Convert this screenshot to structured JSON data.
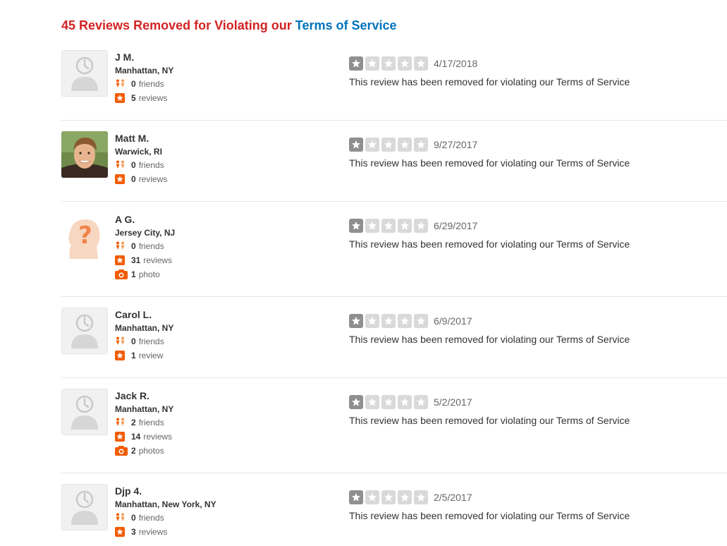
{
  "header": {
    "count_text": "45 Reviews Removed for Violating our",
    "tos_link": "Terms of Service"
  },
  "colors": {
    "header_red": "#d32323",
    "link_blue": "#0073bb",
    "stat_orange": "#f15c00",
    "star_filled": "#8f8f8f",
    "star_empty": "#d9d9d9"
  },
  "reviews": [
    {
      "name": "J M.",
      "location": "Manhattan, NY",
      "avatar": "default-avatar-icon",
      "friends_count": "0",
      "friends_label": "friends",
      "reviews_count": "5",
      "reviews_label": "reviews",
      "rating": 1,
      "date": "4/17/2018",
      "text": "This review has been removed for violating our Terms of Service"
    },
    {
      "name": "Matt M.",
      "location": "Warwick, RI",
      "avatar": "user-photo",
      "friends_count": "0",
      "friends_label": "friends",
      "reviews_count": "0",
      "reviews_label": "reviews",
      "rating": 1,
      "date": "9/27/2017",
      "text": "This review has been removed for violating our Terms of Service"
    },
    {
      "name": "A G.",
      "location": "Jersey City, NJ",
      "avatar": "question-head-icon",
      "friends_count": "0",
      "friends_label": "friends",
      "reviews_count": "31",
      "reviews_label": "reviews",
      "photos_count": "1",
      "photos_label": "photo",
      "rating": 1,
      "date": "6/29/2017",
      "text": "This review has been removed for violating our Terms of Service"
    },
    {
      "name": "Carol L.",
      "location": "Manhattan, NY",
      "avatar": "default-avatar-icon",
      "friends_count": "0",
      "friends_label": "friends",
      "reviews_count": "1",
      "reviews_label": "review",
      "rating": 1,
      "date": "6/9/2017",
      "text": "This review has been removed for violating our Terms of Service"
    },
    {
      "name": "Jack R.",
      "location": "Manhattan, NY",
      "avatar": "default-avatar-icon",
      "friends_count": "2",
      "friends_label": "friends",
      "reviews_count": "14",
      "reviews_label": "reviews",
      "photos_count": "2",
      "photos_label": "photos",
      "rating": 1,
      "date": "5/2/2017",
      "text": "This review has been removed for violating our Terms of Service"
    },
    {
      "name": "Djp 4.",
      "location": "Manhattan, New York, NY",
      "avatar": "default-avatar-icon",
      "friends_count": "0",
      "friends_label": "friends",
      "reviews_count": "3",
      "reviews_label": "reviews",
      "rating": 1,
      "date": "2/5/2017",
      "text": "This review has been removed for violating our Terms of Service"
    }
  ]
}
